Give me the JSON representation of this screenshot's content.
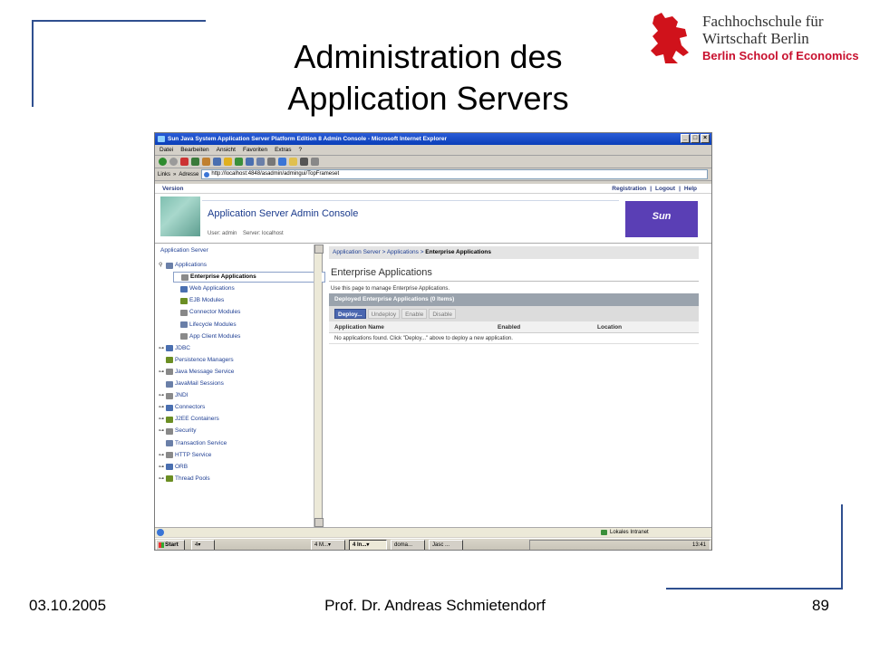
{
  "slide": {
    "title_line1": "Administration des",
    "title_line2": "Application Servers",
    "logo": {
      "line1": "Fachhochschule für",
      "line2": "Wirtschaft Berlin",
      "line3": "Berlin School of Economics"
    },
    "footer": {
      "date": "03.10.2005",
      "author": "Prof. Dr. Andreas Schmietendorf",
      "page": "89"
    }
  },
  "browser": {
    "window_title": "Sun Java System Application Server Platform Edition 8 Admin Console - Microsoft Internet Explorer",
    "window_buttons": [
      "_",
      "□",
      "×"
    ],
    "menu": [
      "Datei",
      "Bearbeiten",
      "Ansicht",
      "Favoriten",
      "Extras",
      "?"
    ],
    "links_label": "Links",
    "links_chevron": "»",
    "address_label": "Adresse",
    "address_value": "http://localhost:4848/asadmin/admingui/TopFrameset",
    "status_zone": "Lokales Intranet"
  },
  "console": {
    "version_link": "Version",
    "top_links": [
      "Registration",
      "Logout",
      "Help"
    ],
    "title": "Application Server Admin Console",
    "user_label": "User:",
    "user_value": "admin",
    "server_label": "Server:",
    "server_value": "localhost",
    "vendor_logo": "Sun"
  },
  "tree": {
    "root": "Application Server",
    "items": [
      {
        "label": "Applications",
        "level": 0,
        "toggle": "⚲"
      },
      {
        "label": "Enterprise Applications",
        "level": 1,
        "selected": true
      },
      {
        "label": "Web Applications",
        "level": 1
      },
      {
        "label": "EJB Modules",
        "level": 1
      },
      {
        "label": "Connector Modules",
        "level": 1
      },
      {
        "label": "Lifecycle Modules",
        "level": 1
      },
      {
        "label": "App Client Modules",
        "level": 1
      },
      {
        "label": "JDBC",
        "level": 0,
        "toggle": "⊶"
      },
      {
        "label": "Persistence Managers",
        "level": 0
      },
      {
        "label": "Java Message Service",
        "level": 0,
        "toggle": "⊶"
      },
      {
        "label": "JavaMail Sessions",
        "level": 0
      },
      {
        "label": "JNDI",
        "level": 0,
        "toggle": "⊶"
      },
      {
        "label": "Connectors",
        "level": 0,
        "toggle": "⊶"
      },
      {
        "label": "J2EE Containers",
        "level": 0,
        "toggle": "⊶"
      },
      {
        "label": "Security",
        "level": 0,
        "toggle": "⊶"
      },
      {
        "label": "Transaction Service",
        "level": 0
      },
      {
        "label": "HTTP Service",
        "level": 0,
        "toggle": "⊶"
      },
      {
        "label": "ORB",
        "level": 0,
        "toggle": "⊶"
      },
      {
        "label": "Thread Pools",
        "level": 0,
        "toggle": "⊶"
      }
    ]
  },
  "content": {
    "breadcrumb": [
      "Application Server",
      "Applications",
      "Enterprise Applications"
    ],
    "breadcrumb_sep": ">",
    "heading": "Enterprise Applications",
    "description": "Use this page to manage Enterprise Applications.",
    "table_title": "Deployed Enterprise Applications (0 Items)",
    "actions": [
      "Deploy...",
      "Undeploy",
      "Enable",
      "Disable"
    ],
    "columns": [
      "Application Name",
      "Enabled",
      "Location"
    ],
    "empty_message": "No applications found. Click \"Deploy...\" above to deploy a new application."
  },
  "taskbar": {
    "start": "Start",
    "tasks": [
      "4▾",
      "4 M...▾",
      "4 In...▾",
      "doma...",
      "Jasc ..."
    ],
    "clock": "13:41"
  }
}
